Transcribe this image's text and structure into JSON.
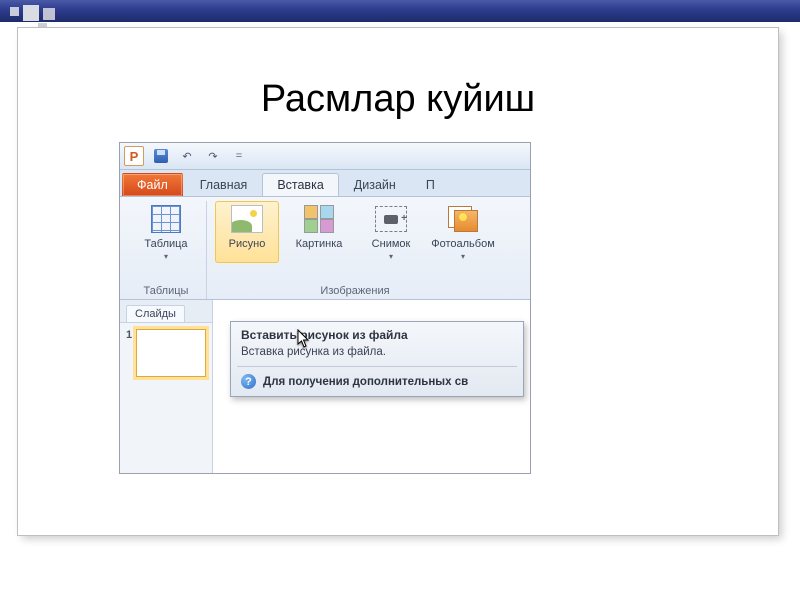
{
  "slide": {
    "title": "Расмлар куйиш"
  },
  "quick_access": {
    "save": "Сохранить",
    "undo": "↶",
    "redo": "↷",
    "overflow": "="
  },
  "tabs": {
    "file": "Файл",
    "home": "Главная",
    "insert": "Вставка",
    "design": "Дизайн",
    "trailing": "П"
  },
  "ribbon": {
    "tables": {
      "button": "Таблица",
      "group": "Таблицы"
    },
    "images": {
      "picture": "Рисуно",
      "clipart": "Картинка",
      "screenshot": "Снимок",
      "album": "Фотоальбом",
      "group": "Изображения"
    }
  },
  "slide_pane": {
    "tab": "Слайды",
    "thumb_number": "1"
  },
  "tooltip": {
    "title": "Вставить рисунок из файла",
    "body": "Вставка рисунка из файла.",
    "help": "Для получения дополнительных св"
  }
}
